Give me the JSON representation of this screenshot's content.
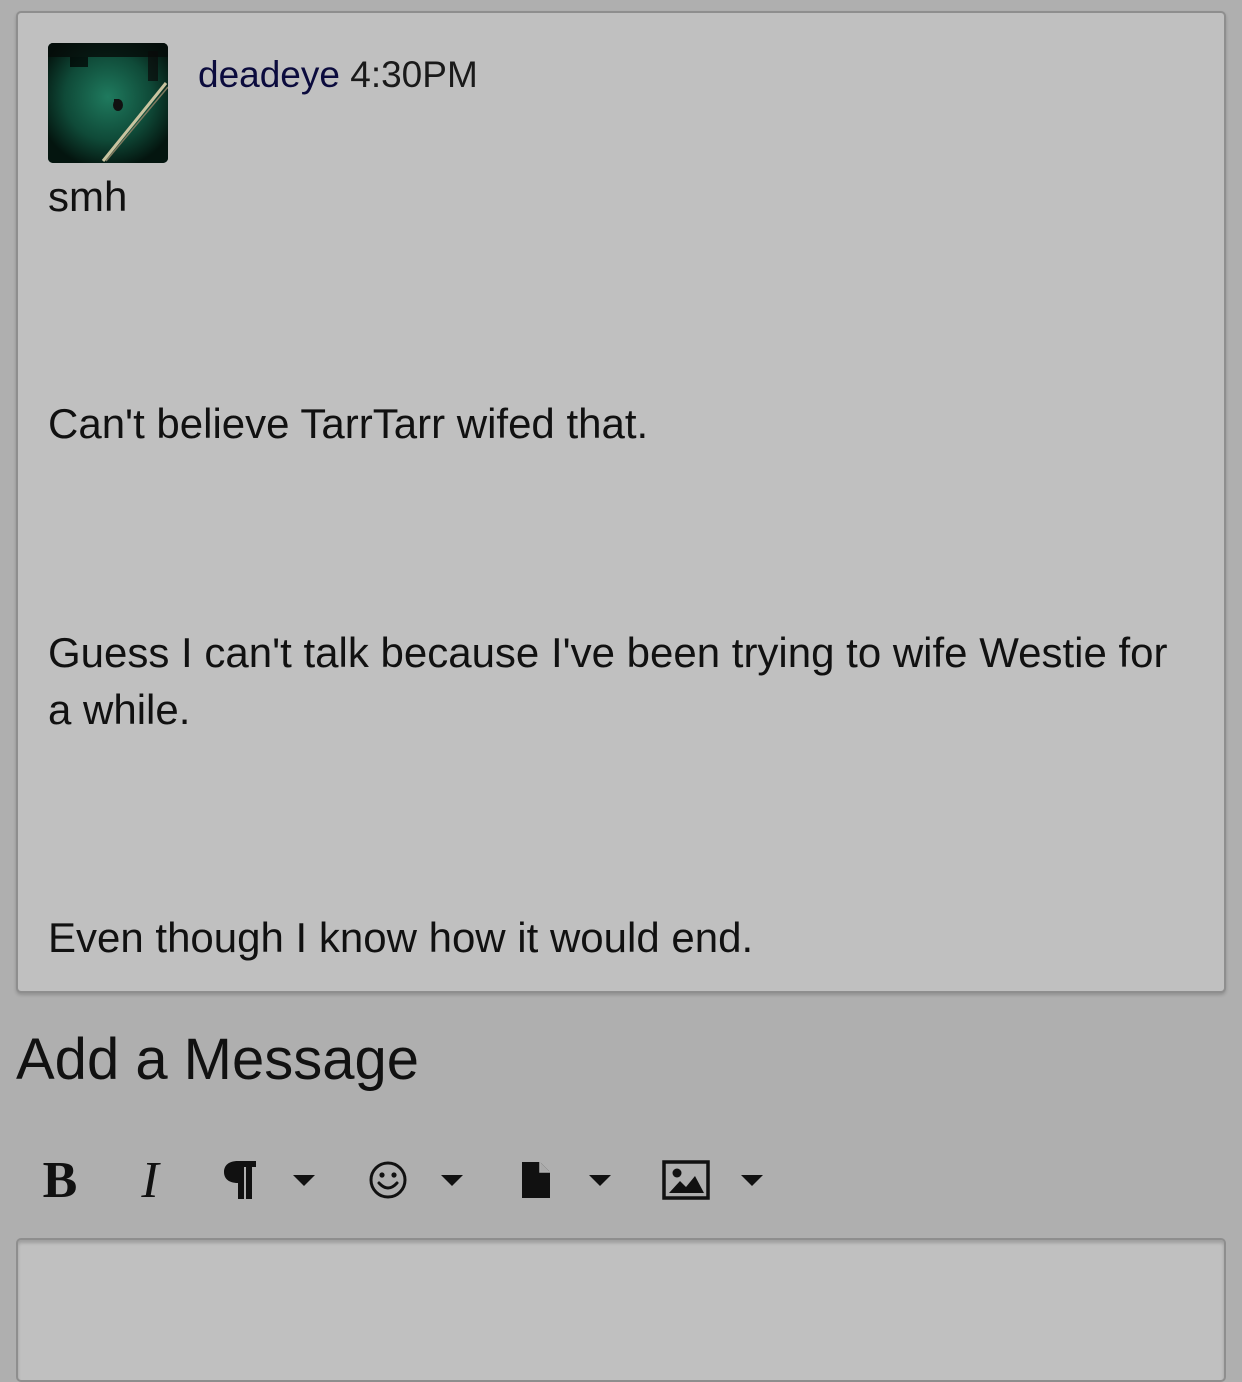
{
  "message": {
    "author": "deadeye",
    "time": "4:30PM",
    "avatar_icon": "pool-table-avatar",
    "paragraphs": [
      "smh",
      "Can't believe TarrTarr wifed that.",
      "Guess I can't talk because I've been trying to wife Westie for a while.",
      "Even though I know how it would end."
    ]
  },
  "composer": {
    "heading": "Add a Message",
    "toolbar": {
      "bold_label": "B",
      "italic_label": "I",
      "icons": [
        "paragraph-icon",
        "emoji-icon",
        "file-icon",
        "image-icon"
      ]
    },
    "placeholder": ""
  },
  "colors": {
    "page_bg": "#afafaf",
    "card_bg": "#c0c0c0",
    "author": "#0b0b3d"
  }
}
